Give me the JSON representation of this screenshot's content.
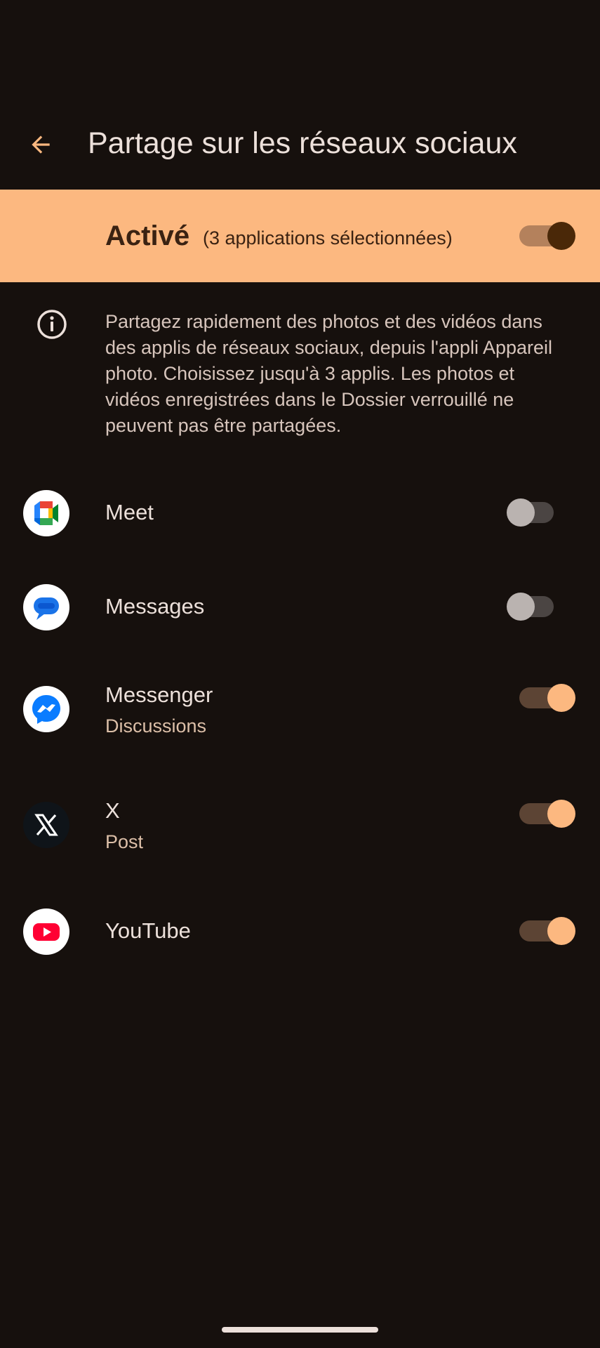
{
  "header": {
    "title": "Partage sur les réseaux sociaux",
    "back_icon": "arrow-left-icon"
  },
  "master": {
    "status": "Activé",
    "count": "(3 applications sélectionnées)",
    "enabled": true,
    "color": "#fcb880"
  },
  "info": {
    "icon": "info-icon",
    "text": "Partagez rapidement des photos et des vidéos dans des applis de réseaux sociaux, depuis l'appli Appareil photo. Choisissez jusqu'à 3 applis. Les photos et vidéos enregistrées dans le Dossier verrouillé ne peuvent pas être partagées."
  },
  "apps": [
    {
      "name": "Meet",
      "subtitle": "",
      "enabled": false,
      "icon": "meet-icon"
    },
    {
      "name": "Messages",
      "subtitle": "",
      "enabled": false,
      "icon": "messages-icon"
    },
    {
      "name": "Messenger",
      "subtitle": "Discussions",
      "enabled": true,
      "icon": "messenger-icon"
    },
    {
      "name": "X",
      "subtitle": "Post",
      "enabled": true,
      "icon": "x-icon"
    },
    {
      "name": "YouTube",
      "subtitle": "",
      "enabled": true,
      "icon": "youtube-icon"
    }
  ],
  "colors": {
    "background": "#16100d",
    "accent": "#fcb880",
    "text": "#ece0da"
  }
}
